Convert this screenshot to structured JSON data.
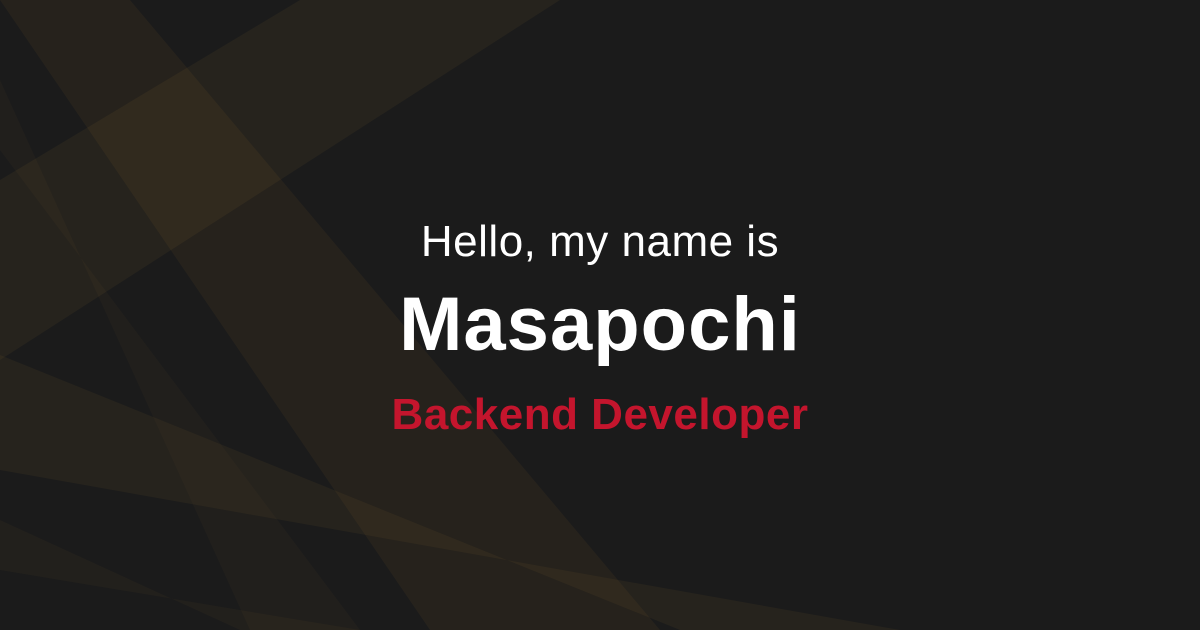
{
  "colors": {
    "background": "#1b1b1b",
    "light_beam": "#b8893a",
    "greeting_text": "#ffffff",
    "name_text": "#ffffff",
    "role_text": "#c4152d"
  },
  "greeting": "Hello, my name is",
  "name": "Masapochi",
  "role": "Backend Developer"
}
